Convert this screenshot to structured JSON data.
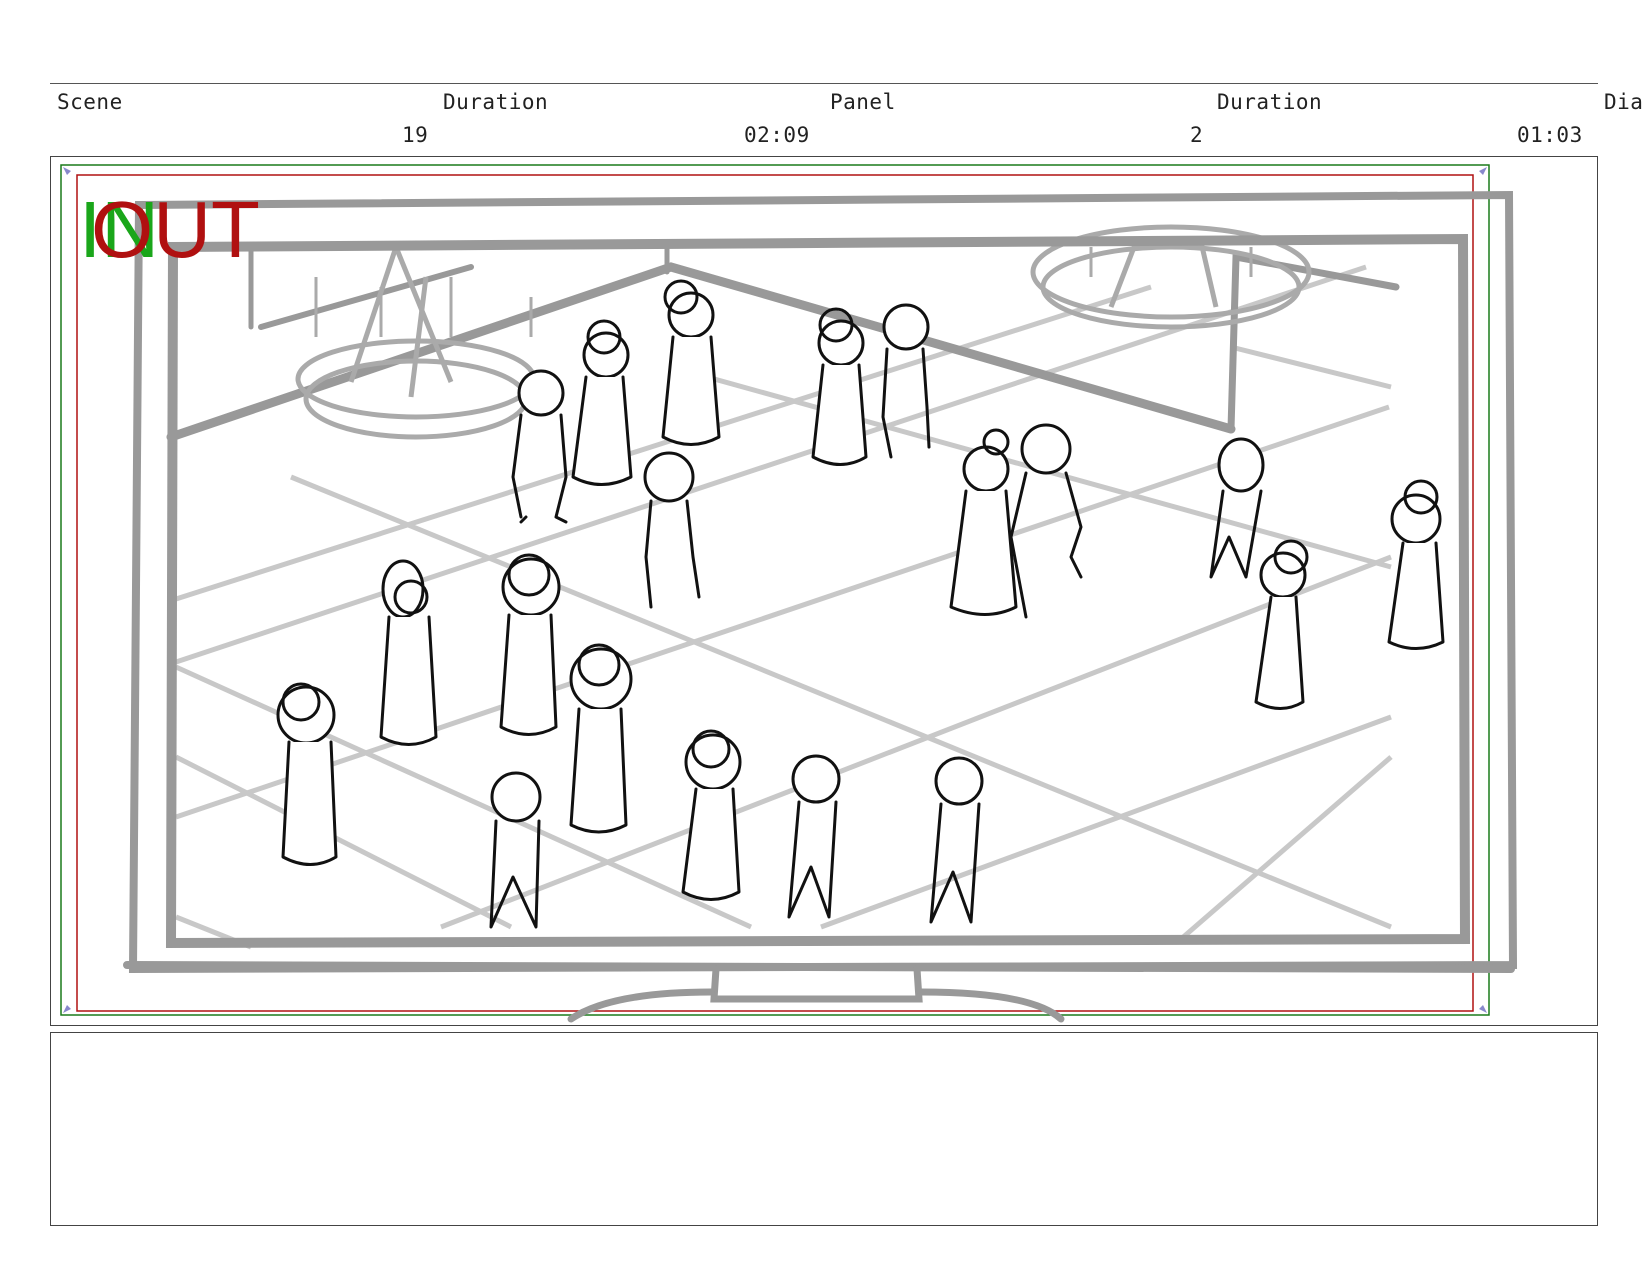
{
  "header": {
    "scene_label": "Scene",
    "duration_label_1": "Duration",
    "panel_label": "Panel",
    "duration_label_2": "Duration",
    "dialog_label": "Dia",
    "scene_value": "19",
    "scene_duration": "02:09",
    "panel_value": "2",
    "panel_duration": "01:03"
  },
  "panel": {
    "in_marker": "IN",
    "out_marker": "OUT",
    "in_color": "#1aa61a",
    "out_color": "#b01010",
    "safe_frame_inner_color": "#b01010",
    "safe_frame_outer_color": "#1a7a1a"
  },
  "notes": {
    "text": ""
  }
}
